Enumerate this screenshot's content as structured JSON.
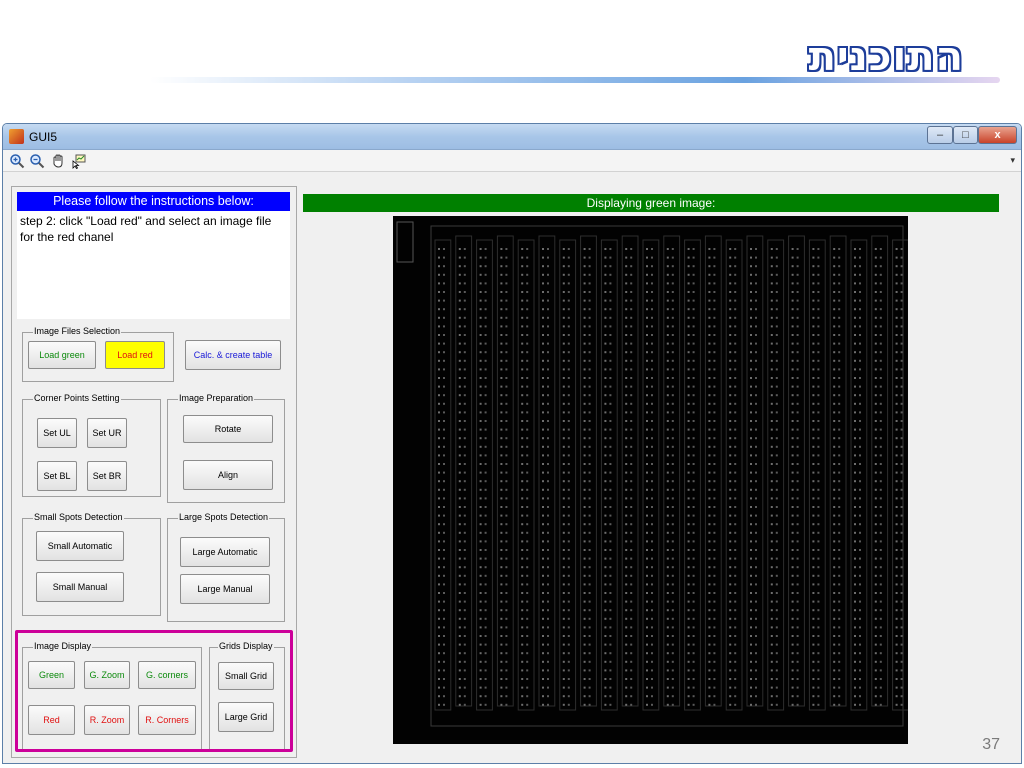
{
  "slide": {
    "title": "התוכנית",
    "page_number": "37"
  },
  "window": {
    "title": "GUI5",
    "controls": {
      "minimize": "–",
      "maximize": "□",
      "close": "x"
    }
  },
  "toolbar": {
    "icons": [
      "zoom-in-icon",
      "zoom-out-icon",
      "pan-hand-icon",
      "data-cursor-icon"
    ],
    "menu_arrow": "▾"
  },
  "instructions": {
    "header": "Please follow the instructions below:",
    "text": "step 2: click \"Load red\" and select an image file for the red chanel"
  },
  "image_files": {
    "title": "Image Files Selection",
    "load_green": "Load green",
    "load_red": "Load red",
    "calc": "Calc. & create table"
  },
  "corner_points": {
    "title": "Corner Points Setting",
    "set_ul": "Set UL",
    "set_ur": "Set UR",
    "set_bl": "Set BL",
    "set_br": "Set BR"
  },
  "image_preparation": {
    "title": "Image Preparation",
    "rotate": "Rotate",
    "align": "Align"
  },
  "small_spots": {
    "title": "Small Spots Detection",
    "automatic": "Small Automatic",
    "manual": "Small Manual"
  },
  "large_spots": {
    "title": "Large Spots Detection",
    "automatic": "Large Automatic",
    "manual": "Large Manual"
  },
  "image_display": {
    "title": "Image Display",
    "green": "Green",
    "g_zoom": "G. Zoom",
    "g_corners": "G. corners",
    "red": "Red",
    "r_zoom": "R. Zoom",
    "r_corners": "R. Corners"
  },
  "grids_display": {
    "title": "Grids Display",
    "small_grid": "Small Grid",
    "large_grid": "Large Grid"
  },
  "display": {
    "header": "Displaying green image:"
  },
  "colors": {
    "instruction_header": "#0000ff",
    "display_header": "#008000",
    "load_red_bg": "#ffff00",
    "highlight_border": "#cc0099",
    "green_text": "#0c8a0c",
    "red_text": "#e01010",
    "calc_text": "#1a1ad8"
  }
}
